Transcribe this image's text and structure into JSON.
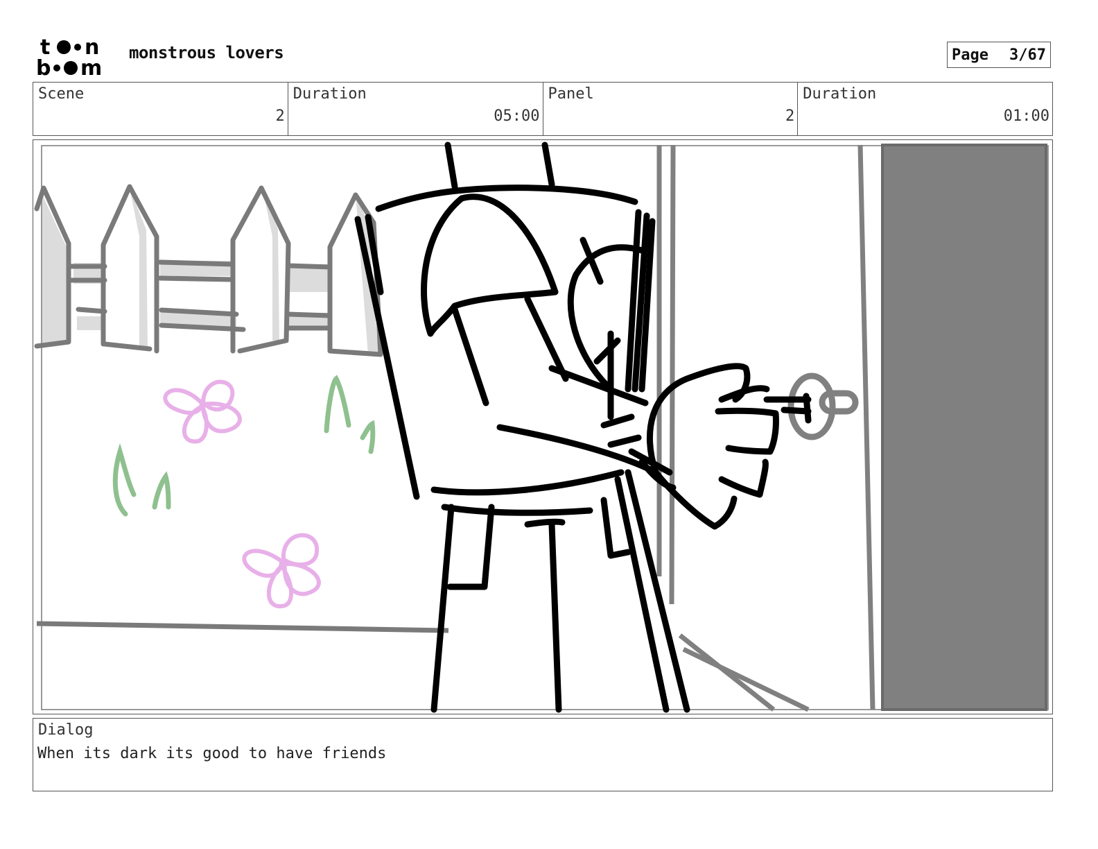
{
  "header": {
    "logo_icon": "toon-boom-logo",
    "logo_text": "toon boom",
    "project_title": "monstrous lovers",
    "page_label": "Page",
    "page_value": "3/67"
  },
  "info": {
    "scene_label": "Scene",
    "scene_value": "2",
    "scene_duration_label": "Duration",
    "scene_duration_value": "05:00",
    "panel_label": "Panel",
    "panel_value": "2",
    "panel_duration_label": "Duration",
    "panel_duration_value": "01:00"
  },
  "panel": {
    "image_icon": "storyboard-sketch-image",
    "colors": {
      "fence": "#7a7a7a",
      "fence_shade": "#dcdcdc",
      "flower": "#e8b0e8",
      "grass": "#8fc08f",
      "door": "#808080",
      "ink": "#000000"
    }
  },
  "dialog": {
    "label": "Dialog",
    "text": "When its dark its good to have friends"
  }
}
